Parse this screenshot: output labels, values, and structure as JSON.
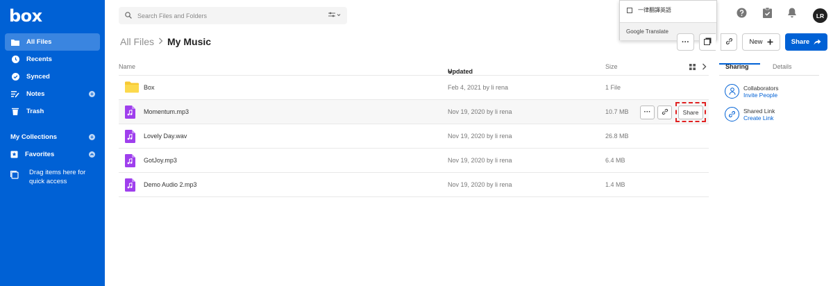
{
  "brand": {
    "logo": "box",
    "accent": "#0061d5"
  },
  "sidebar": {
    "items": [
      {
        "label": "All Files",
        "icon": "folder-icon",
        "active": true
      },
      {
        "label": "Recents",
        "icon": "clock-icon"
      },
      {
        "label": "Synced",
        "icon": "check-circle-icon"
      },
      {
        "label": "Notes",
        "icon": "notes-icon"
      },
      {
        "label": "Trash",
        "icon": "trash-icon"
      }
    ],
    "collections_label": "My Collections",
    "favorites_label": "Favorites",
    "drag_hint": "Drag items here for quick access"
  },
  "search": {
    "placeholder": "Search Files and Folders"
  },
  "translate_popup": {
    "option": "一律翻譯英語",
    "footer": "Google Translate"
  },
  "user": {
    "initials": "LR"
  },
  "breadcrumb": {
    "parent": "All Files",
    "current": "My Music"
  },
  "header_buttons": {
    "more": "···",
    "new": "New",
    "share": "Share"
  },
  "table": {
    "columns": {
      "name": "Name",
      "updated": "Updated",
      "size": "Size"
    },
    "rows": [
      {
        "type": "folder",
        "name": "Box",
        "updated": "Feb 4, 2021 by li rena",
        "size": "1 File"
      },
      {
        "type": "audio",
        "name": "Momentum.mp3",
        "updated": "Nov 19, 2020 by li rena",
        "size": "10.7 MB",
        "hover": true,
        "share_label": "Share",
        "more_label": "···"
      },
      {
        "type": "audio",
        "name": "Lovely Day.wav",
        "updated": "Nov 19, 2020 by li rena",
        "size": "26.8 MB"
      },
      {
        "type": "audio",
        "name": "GotJoy.mp3",
        "updated": "Nov 19, 2020 by li rena",
        "size": "6.4 MB"
      },
      {
        "type": "audio",
        "name": "Demo Audio 2.mp3",
        "updated": "Nov 19, 2020 by li rena",
        "size": "1.4 MB"
      }
    ]
  },
  "right_panel": {
    "tabs": [
      "Sharing",
      "Details"
    ],
    "collaborators": {
      "title": "Collaborators",
      "link": "Invite People"
    },
    "shared_link": {
      "title": "Shared Link",
      "link": "Create Link"
    }
  }
}
